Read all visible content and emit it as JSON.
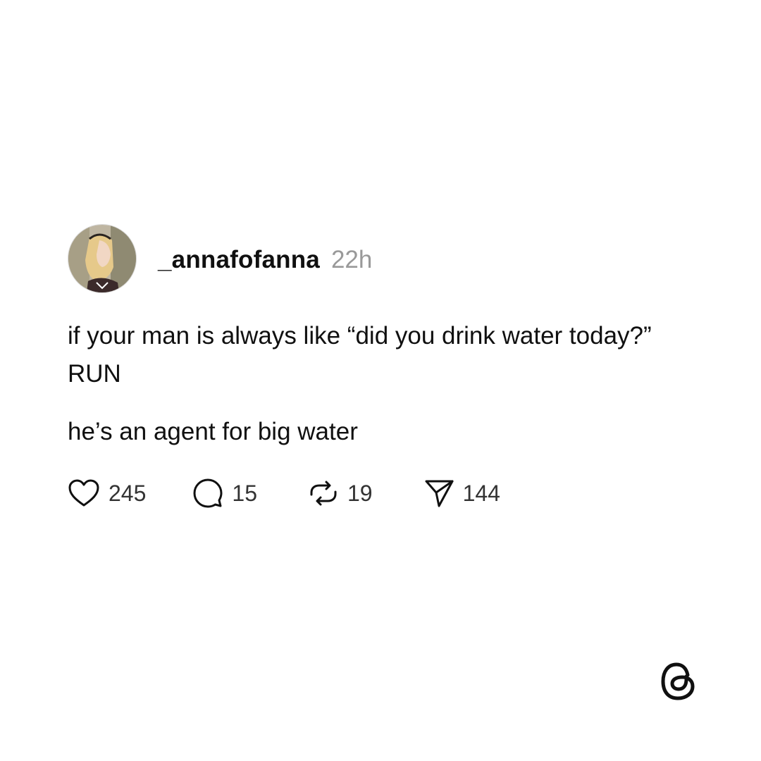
{
  "post": {
    "author": {
      "username": "_annafofanna",
      "avatar_icon": "profile-avatar"
    },
    "timestamp": "22h",
    "body": {
      "paragraph_1": "if your man is always like “did you drink water today?” RUN",
      "paragraph_2": "he’s an agent for big water"
    },
    "actions": {
      "like": {
        "icon": "heart-icon",
        "count": "245"
      },
      "reply": {
        "icon": "comment-icon",
        "count": "15"
      },
      "repost": {
        "icon": "repost-icon",
        "count": "19"
      },
      "share": {
        "icon": "send-icon",
        "count": "144"
      }
    }
  },
  "branding": {
    "logo_icon": "threads-logo-icon"
  },
  "colors": {
    "text": "#101010",
    "muted": "#999999",
    "background": "#ffffff"
  }
}
